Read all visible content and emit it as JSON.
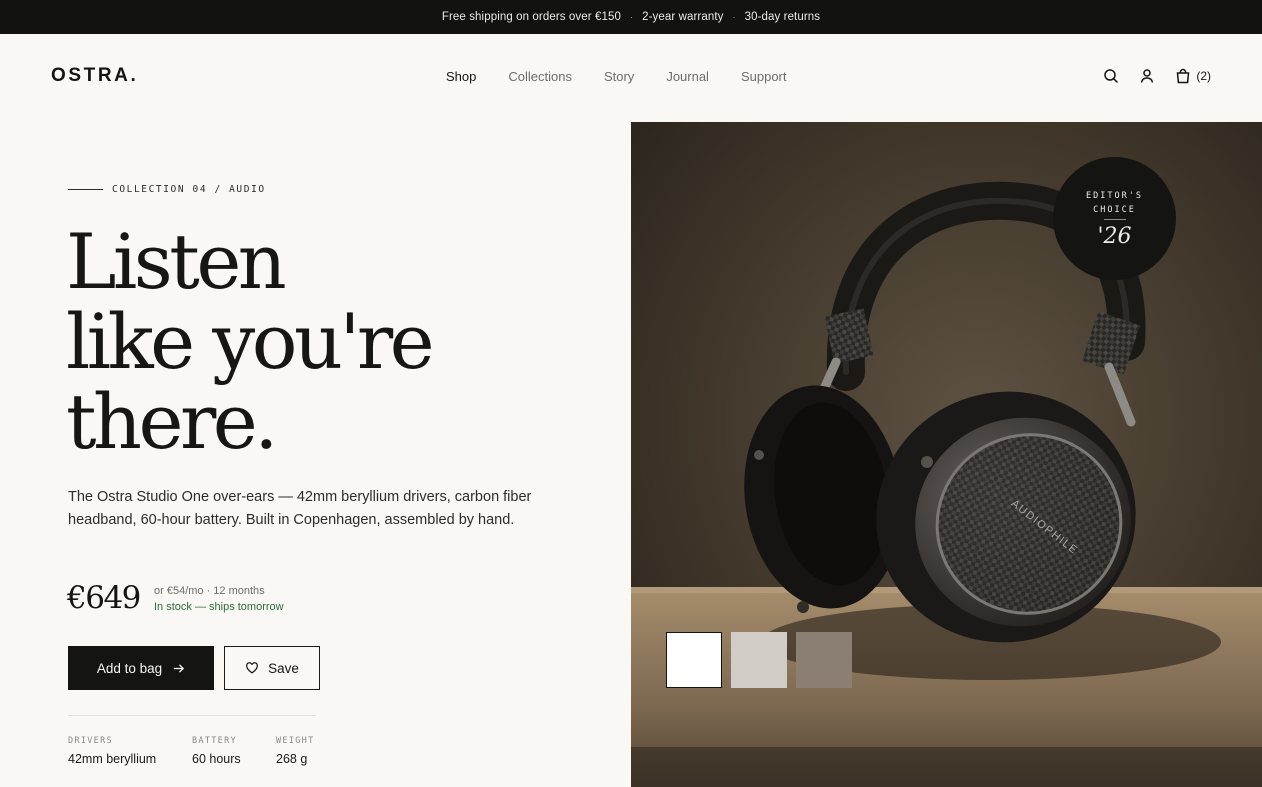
{
  "announcement": {
    "items": [
      "Free shipping on orders over €150",
      "2-year warranty",
      "30-day returns"
    ],
    "separator": "·"
  },
  "header": {
    "logo": "OSTRA.",
    "nav": [
      {
        "label": "Shop",
        "active": true
      },
      {
        "label": "Collections",
        "active": false
      },
      {
        "label": "Story",
        "active": false
      },
      {
        "label": "Journal",
        "active": false
      },
      {
        "label": "Support",
        "active": false
      }
    ],
    "icons": [
      "search-icon",
      "account-icon",
      "bag-icon"
    ],
    "cart_count": "(2)"
  },
  "hero": {
    "eyebrow": "COLLECTION 04 / AUDIO",
    "headline": [
      "Listen",
      "like you're",
      "there."
    ],
    "description": "The Ostra Studio One over-ears — 42mm beryllium drivers, carbon fiber headband, 60-hour battery. Built in Copenhagen, assembled by hand.",
    "price": "€649",
    "monthly": "or €54/mo · 12 months",
    "stock": "In stock — ships tomorrow",
    "add_to_bag": "Add to bag",
    "save": "Save",
    "specs": [
      {
        "label": "DRIVERS",
        "value": "42mm beryllium"
      },
      {
        "label": "BATTERY",
        "value": "60 hours"
      },
      {
        "label": "WEIGHT",
        "value": "268 g"
      }
    ]
  },
  "product_image": {
    "badge_line1": "EDITOR'S",
    "badge_line2": "CHOICE",
    "badge_year": "'26",
    "earcup_text": "AUDIOPHILE",
    "swatches": [
      {
        "color": "#ffffff",
        "selected": true
      },
      {
        "color": "#d1ccc5",
        "selected": false
      },
      {
        "color": "#8a7f72",
        "selected": false
      }
    ]
  },
  "colors": {
    "dark": "#141412",
    "background": "#f9f8f4",
    "stock_green": "#2f6b3d"
  }
}
